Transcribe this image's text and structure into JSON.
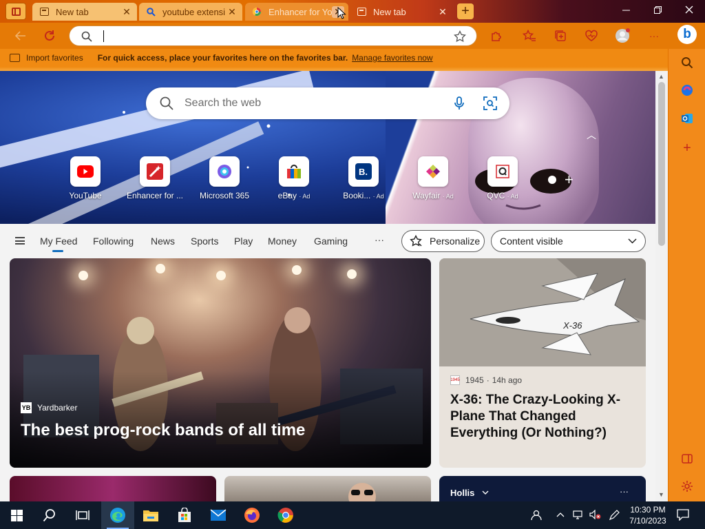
{
  "tabs": [
    {
      "title": "New tab",
      "icon": "newtab-icon"
    },
    {
      "title": "youtube extensi",
      "icon": "search-icon"
    },
    {
      "title": "Enhancer for Yo",
      "icon": "enhancer-icon"
    },
    {
      "title": "New tab",
      "icon": "newtab-icon"
    }
  ],
  "toolbar": {
    "address_value": "",
    "close_glyph": "✕"
  },
  "favorites_bar": {
    "import_label": "Import favorites",
    "message": "For quick access, place your favorites here on the favorites bar.",
    "manage_link": "Manage favorites now"
  },
  "hero": {
    "search_placeholder": "Search the web",
    "quick_links": [
      {
        "label": "YouTube",
        "ad": ""
      },
      {
        "label": "Enhancer for ...",
        "ad": ""
      },
      {
        "label": "Microsoft 365",
        "ad": ""
      },
      {
        "label": "eBay",
        "ad": "· Ad"
      },
      {
        "label": "Booki...",
        "ad": "· Ad"
      },
      {
        "label": "Wayfair",
        "ad": "· Ad"
      },
      {
        "label": "QVC",
        "ad": "· Ad"
      }
    ]
  },
  "feed_nav": {
    "items": [
      "My Feed",
      "Following",
      "News",
      "Sports",
      "Play",
      "Money",
      "Gaming"
    ],
    "more": "···",
    "personalize": "Personalize",
    "content_visible": "Content visible"
  },
  "cards": {
    "main": {
      "source": "Yardbarker",
      "source_logo": "YB",
      "headline": "The best prog-rock bands of all time"
    },
    "side": {
      "source": "1945",
      "time": "14h ago",
      "headline": "X-36: The Crazy-Looking X-Plane That Changed Everything (Or Nothing?)",
      "plane_label": "X-36"
    },
    "weather": {
      "location": "Hollis",
      "more": "···"
    }
  },
  "taskbar": {
    "time": "10:30 PM",
    "date": "7/10/2023"
  },
  "colors": {
    "accent": "#e57a06",
    "link": "#0f6cbd"
  }
}
